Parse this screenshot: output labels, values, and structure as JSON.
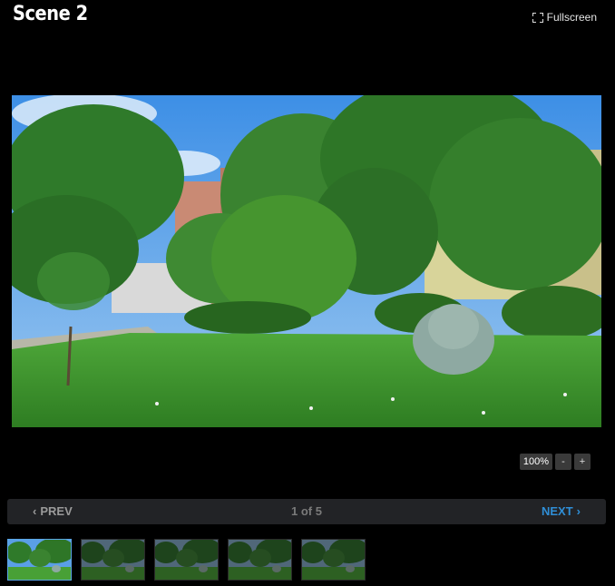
{
  "header": {
    "title": "Scene 2",
    "fullscreen_label": "Fullscreen"
  },
  "viewer": {
    "image_icon": "park-scene-image"
  },
  "zoom": {
    "level": "100%",
    "minus": "-",
    "plus": "+"
  },
  "nav": {
    "prev_label": "PREV",
    "next_label": "NEXT",
    "prev_chevron": "‹",
    "next_chevron": "›",
    "counter": "1 of 5"
  },
  "colors": {
    "next_accent": "#2f8ed6",
    "active_thumb_border": "#5aa6e6"
  }
}
